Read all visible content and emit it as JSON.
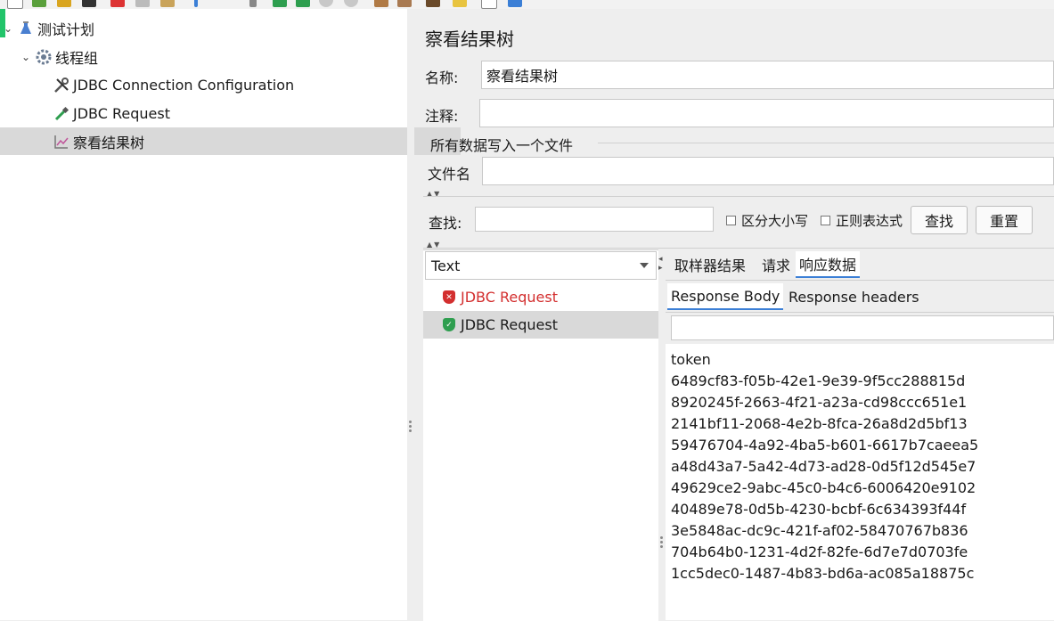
{
  "colors": {
    "accent": "#3b7fd6",
    "error": "#d32f2f",
    "success": "#2e9e4f",
    "selected_bg": "#d9d9d9"
  },
  "tree": {
    "items": [
      {
        "label": "测试计划",
        "icon": "flask-icon"
      },
      {
        "label": "线程组",
        "icon": "gear-icon"
      },
      {
        "label": "JDBC Connection Configuration",
        "icon": "wrench-icon"
      },
      {
        "label": "JDBC Request",
        "icon": "pipette-icon"
      },
      {
        "label": "察看结果树",
        "icon": "chart-icon"
      }
    ]
  },
  "panel": {
    "title": "察看结果树",
    "name_label": "名称:",
    "name_value": "察看结果树",
    "comment_label": "注释:",
    "comment_value": "",
    "file_section_title": "所有数据写入一个文件",
    "filename_label": "文件名",
    "filename_value": ""
  },
  "search": {
    "label": "查找:",
    "value": "",
    "case_sensitive_label": "区分大小写",
    "regex_label": "正则表达式",
    "find_button": "查找",
    "reset_button": "重置"
  },
  "renderer": {
    "selected": "Text"
  },
  "results": [
    {
      "label": "JDBC Request",
      "status": "error"
    },
    {
      "label": "JDBC Request",
      "status": "success"
    }
  ],
  "tabs": {
    "main": [
      "取样器结果",
      "请求",
      "响应数据"
    ],
    "sub": [
      "Response Body",
      "Response headers"
    ]
  },
  "response": {
    "search_value": "",
    "body": "token\n6489cf83-f05b-42e1-9e39-9f5cc288815d\n8920245f-2663-4f21-a23a-cd98ccc651e1\n2141bf11-2068-4e2b-8fca-26a8d2d5bf13\n59476704-4a92-4ba5-b601-6617b7caeea5\na48d43a7-5a42-4d73-ad28-0d5f12d545e7\n49629ce2-9abc-45c0-b4c6-6006420e9102\n40489e78-0d5b-4230-bcbf-6c634393f44f\n3e5848ac-dc9c-421f-af02-58470767b836\n704b64b0-1231-4d2f-82fe-6d7e7d0703fe\n1cc5dec0-1487-4b83-bd6a-ac085a18875c"
  }
}
